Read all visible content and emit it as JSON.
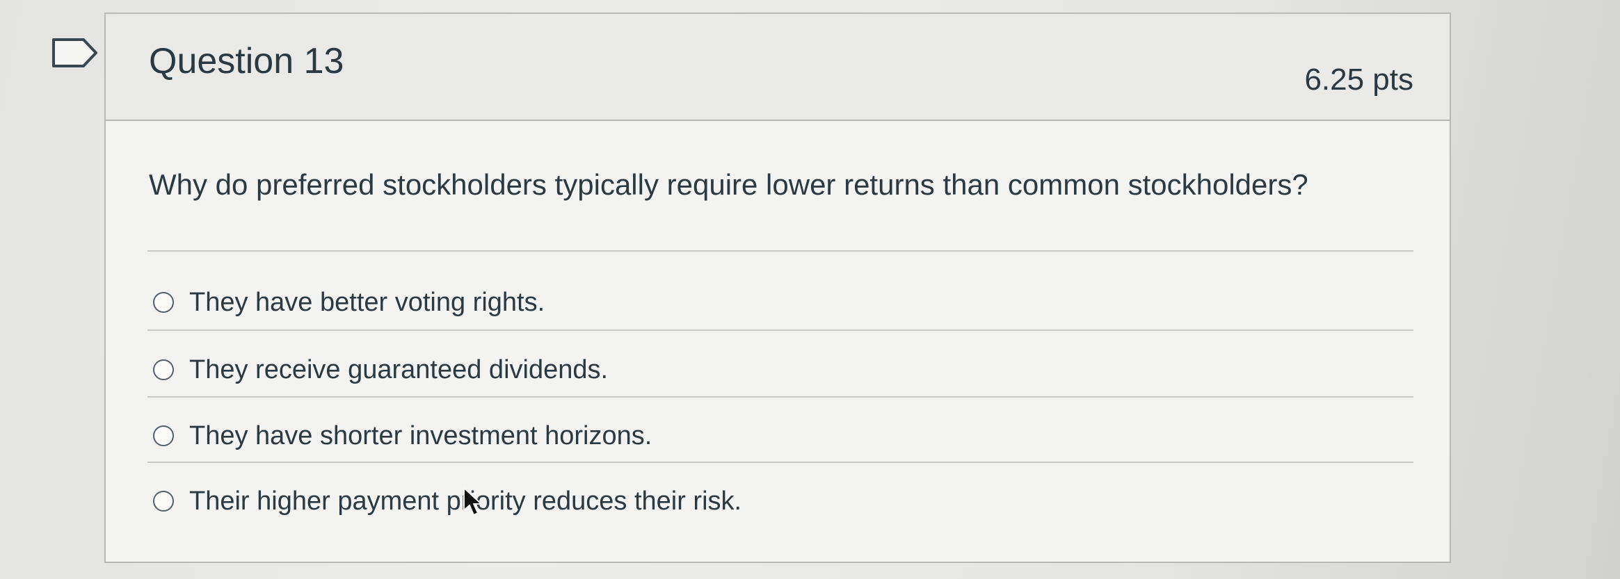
{
  "question": {
    "title": "Question 13",
    "points": "6.25 pts",
    "text": "Why do preferred stockholders typically require lower returns than common stockholders?"
  },
  "answers": [
    {
      "label": "They have better voting rights.",
      "selected": false
    },
    {
      "label": "They receive guaranteed dividends.",
      "selected": false
    },
    {
      "label": "They have shorter investment horizons.",
      "selected": false
    },
    {
      "label": "Their higher payment priority reduces their risk.",
      "selected": false
    }
  ],
  "icons": {
    "flag": "flag-question-icon",
    "cursor": "mouse-pointer-icon"
  },
  "colors": {
    "text": "#2b3942",
    "header_bg": "#e9e9e7",
    "card_bg": "#f3f3f1",
    "border": "#b8b8b6"
  }
}
